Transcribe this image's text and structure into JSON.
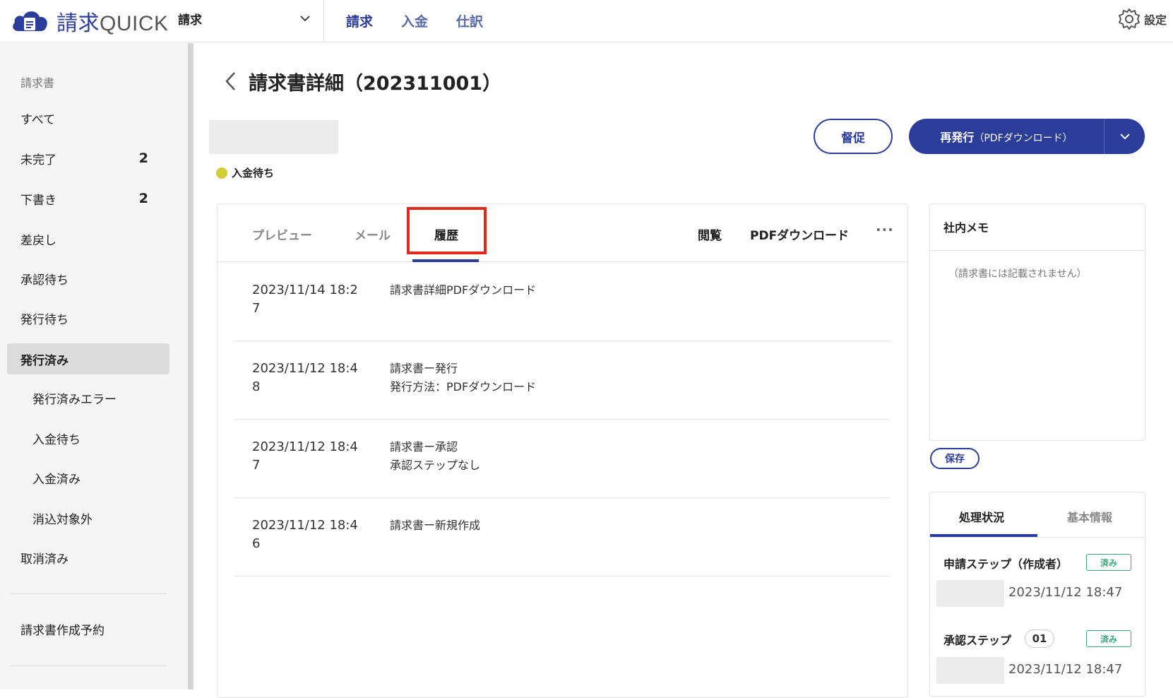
{
  "app": {
    "brand_main": "請求",
    "brand_sub": "QUICK",
    "selector_label": "請求",
    "settings_label": "設定"
  },
  "topnav": {
    "items": [
      {
        "label": "請求"
      },
      {
        "label": "入金"
      },
      {
        "label": "仕訳"
      }
    ]
  },
  "sidebar": {
    "heading": "請求書",
    "items": [
      {
        "label": "すべて",
        "count": ""
      },
      {
        "label": "未完了",
        "count": "2"
      },
      {
        "label": "下書き",
        "count": "2"
      },
      {
        "label": "差戻し",
        "count": ""
      },
      {
        "label": "承認待ち",
        "count": ""
      },
      {
        "label": "発行待ち",
        "count": ""
      },
      {
        "label": "発行済み",
        "count": ""
      },
      {
        "label": "発行済みエラー",
        "count": ""
      },
      {
        "label": "入金待ち",
        "count": ""
      },
      {
        "label": "入金済み",
        "count": ""
      },
      {
        "label": "消込対象外",
        "count": ""
      },
      {
        "label": "取消済み",
        "count": ""
      },
      {
        "label": "請求書作成予約",
        "count": ""
      }
    ]
  },
  "page": {
    "title": "請求書詳細（202311001）",
    "status": "入金待ち",
    "remind_button": "督促",
    "reissue_button": "再発行",
    "reissue_sub": "（PDFダウンロード）"
  },
  "tabs": {
    "preview": "プレビュー",
    "mail": "メール",
    "history": "履歴",
    "view": "閲覧",
    "pdf_download": "PDFダウンロード",
    "more": "···"
  },
  "history": [
    {
      "date": "2023/11/14 18:27",
      "line1": "請求書詳細PDFダウンロード",
      "line2": ""
    },
    {
      "date": "2023/11/12 18:48",
      "line1": "請求書ー発行",
      "line2": "発行方法：PDFダウンロード"
    },
    {
      "date": "2023/11/12 18:47",
      "line1": "請求書ー承認",
      "line2": "承認ステップなし"
    },
    {
      "date": "2023/11/12 18:46",
      "line1": "請求書ー新規作成",
      "line2": ""
    }
  ],
  "memo": {
    "title": "社内メモ",
    "placeholder": "（請求書には記載されません）",
    "save_button": "保存"
  },
  "status_card": {
    "tab_progress": "処理状況",
    "tab_basic": "基本情報",
    "steps": [
      {
        "label": "申請ステップ（作成者）",
        "num": "",
        "badge": "済み",
        "time": "2023/11/12 18:47"
      },
      {
        "label": "承認ステップ",
        "num": "01",
        "badge": "済み",
        "time": "2023/11/12 18:47"
      }
    ]
  },
  "colors": {
    "brand": "#2b3d9a",
    "status_dot": "#d3cc3a",
    "highlight": "#e3281e",
    "done_badge": "#3aa77a"
  }
}
